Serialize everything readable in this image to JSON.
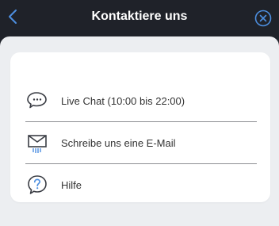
{
  "header": {
    "title": "Kontaktiere uns",
    "back_icon": "chevron-left-icon",
    "close_icon": "close-circle-icon"
  },
  "menu": {
    "items": [
      {
        "label": "Live Chat (10:00 bis 22:00)",
        "icon": "chat-bubbles-icon"
      },
      {
        "label": "Schreibe uns eine E-Mail",
        "icon": "envelope-icon"
      },
      {
        "label": "Hilfe",
        "icon": "help-question-icon"
      }
    ]
  },
  "colors": {
    "header_bg": "#1f2229",
    "accent": "#4d8fe0",
    "content_bg": "#eceef1",
    "card_bg": "#ffffff",
    "text": "#333333",
    "divider": "#8d8f93"
  }
}
